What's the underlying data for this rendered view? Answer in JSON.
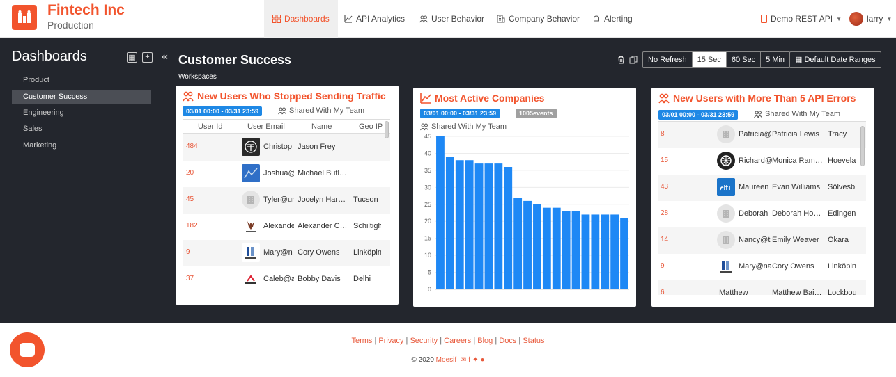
{
  "header": {
    "brand": "Fintech Inc",
    "environment": "Production",
    "nav": [
      "Dashboards",
      "API Analytics",
      "User Behavior",
      "Company Behavior",
      "Alerting"
    ],
    "api_selector": "Demo REST API",
    "user": "larry"
  },
  "sidebar": {
    "title": "Dashboards",
    "items": [
      "Product",
      "Customer Success",
      "Engineering",
      "Sales",
      "Marketing"
    ]
  },
  "main": {
    "title": "Customer Success",
    "subtitle": "Workspaces",
    "refresh_options": [
      "No Refresh",
      "15 Sec",
      "60 Sec",
      "5 Min"
    ],
    "selected_refresh": "15 Sec",
    "date_range_button": "Default Date Ranges"
  },
  "card1": {
    "title": "New Users Who Stopped Sending Traffic",
    "date_range": "03/01 00:00 - 03/31 23:59",
    "shared": "Shared With My Team",
    "columns": [
      "User Id",
      "User Email",
      "Name",
      "Geo IP"
    ],
    "rows": [
      {
        "id": "484",
        "email": "Christop",
        "name": "Jason Frey",
        "geo": ""
      },
      {
        "id": "20",
        "email": "Joshua@",
        "name": "Michael Butl…",
        "geo": ""
      },
      {
        "id": "45",
        "email": "Tyler@ur",
        "name": "Jocelyn Har…",
        "geo": "Tucson"
      },
      {
        "id": "182",
        "email": "Alexande",
        "name": "Alexander C…",
        "geo": "Schiltigh"
      },
      {
        "id": "9",
        "email": "Mary@n",
        "name": "Cory Owens",
        "geo": "Linköpin"
      },
      {
        "id": "37",
        "email": "Caleb@a",
        "name": "Bobby Davis",
        "geo": "Delhi"
      }
    ]
  },
  "card2": {
    "title": "Most Active Companies",
    "date_range": "03/01 00:00 - 03/31 23:59",
    "events": "1005events",
    "shared": "Shared With My Team"
  },
  "card3": {
    "title": "New Users with More Than 5 API Errors",
    "date_range": "03/01 00:00 - 03/31 23:59",
    "shared": "Shared With My Team",
    "rows": [
      {
        "id": "8",
        "email": "Patricia@",
        "name": "Patricia Lewis",
        "geo": "Tracy"
      },
      {
        "id": "15",
        "email": "Richard@",
        "name": "Monica Ram…",
        "geo": "Hoevela"
      },
      {
        "id": "43",
        "email": "Maureen",
        "name": "Evan Williams",
        "geo": "Sölvesb"
      },
      {
        "id": "28",
        "email": "Deborah",
        "name": "Deborah Ho…",
        "geo": "Edingen"
      },
      {
        "id": "14",
        "email": "Nancy@t",
        "name": "Emily Weaver",
        "geo": "Okara"
      },
      {
        "id": "9",
        "email": "Mary@na",
        "name": "Cory Owens",
        "geo": "Linköpin"
      },
      {
        "id": "6",
        "email": "Matthew",
        "name": "Matthew Bai…",
        "geo": "Lockbou"
      }
    ]
  },
  "chart_data": {
    "type": "bar",
    "values": [
      45,
      39,
      38,
      38,
      37,
      37,
      37,
      36,
      27,
      26,
      25,
      24,
      24,
      23,
      23,
      22,
      22,
      22,
      22,
      21
    ],
    "ylim": [
      0,
      45
    ],
    "yticks": [
      0,
      5,
      10,
      15,
      20,
      25,
      30,
      35,
      40,
      45
    ],
    "bar_color": "#1e88f5",
    "grid": true
  },
  "footer": {
    "links": [
      "Terms",
      "Privacy",
      "Security",
      "Careers",
      "Blog",
      "Docs",
      "Status"
    ],
    "copyright": "© 2020",
    "brand": "Moesif"
  },
  "colors": {
    "accent": "#f2542d",
    "dark_bg": "#23262d",
    "badge_blue": "#1e88e5"
  }
}
